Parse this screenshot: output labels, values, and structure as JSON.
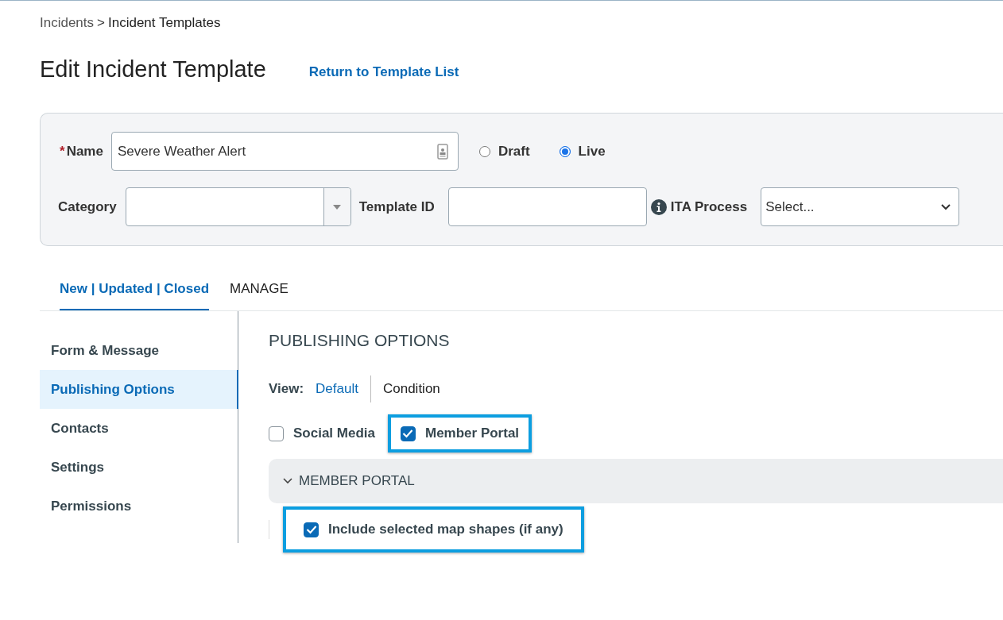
{
  "breadcrumb": {
    "link": "Incidents",
    "separator": ">",
    "current": "Incident Templates"
  },
  "page_title": "Edit Incident Template",
  "return_link": "Return to Template List",
  "form": {
    "name": {
      "label": "Name",
      "required_mark": "*",
      "value": "Severe Weather Alert"
    },
    "status_options": [
      {
        "label": "Draft",
        "selected": false
      },
      {
        "label": "Live",
        "selected": true
      }
    ],
    "category": {
      "label": "Category"
    },
    "template_id": {
      "label": "Template ID"
    },
    "ita_process": {
      "label": "ITA Process",
      "value": "Select..."
    }
  },
  "tabs": [
    {
      "label": "New | Updated | Closed",
      "selected": true
    },
    {
      "label": "MANAGE",
      "selected": false
    }
  ],
  "sidebar": {
    "items": [
      {
        "label": "Form & Message",
        "selected": false
      },
      {
        "label": "Publishing Options",
        "selected": true
      },
      {
        "label": "Contacts",
        "selected": false
      },
      {
        "label": "Settings",
        "selected": false
      },
      {
        "label": "Permissions",
        "selected": false
      }
    ]
  },
  "content": {
    "heading": "PUBLISHING OPTIONS",
    "view": {
      "label": "View:",
      "options": [
        {
          "label": "Default",
          "selected": true
        },
        {
          "label": "Condition",
          "selected": false
        }
      ]
    },
    "channels": [
      {
        "label": "Social Media",
        "checked": false,
        "highlighted": false
      },
      {
        "label": "Member Portal",
        "checked": true,
        "highlighted": true
      }
    ],
    "section": {
      "title": "MEMBER PORTAL",
      "expanded": true,
      "options": [
        {
          "label": "Include selected map shapes (if any)",
          "checked": true,
          "highlighted": true
        }
      ]
    }
  }
}
